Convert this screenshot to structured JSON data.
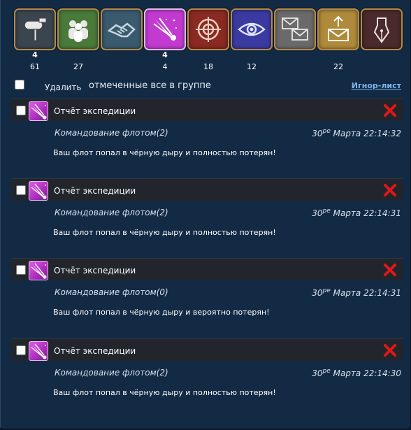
{
  "categories": [
    {
      "name": "postbox",
      "icon": "mailbox-icon",
      "new": "4",
      "count": "61",
      "bg": "#3a4550"
    },
    {
      "name": "alliance",
      "icon": "people-icon",
      "new": "",
      "count": "27",
      "bg": "#4a7a3a"
    },
    {
      "name": "trade",
      "icon": "handshake-icon",
      "new": "",
      "count": "",
      "bg": "#3a5a6e"
    },
    {
      "name": "expeditions",
      "icon": "comet-icon",
      "new": "4",
      "count": "4",
      "bg": "#c23ad0"
    },
    {
      "name": "combat",
      "icon": "crosshair-icon",
      "new": "",
      "count": "18",
      "bg": "#8a2a22"
    },
    {
      "name": "espionage",
      "icon": "eye-icon",
      "new": "",
      "count": "12",
      "bg": "#3a3aa0"
    },
    {
      "name": "system",
      "icon": "envelopes-icon",
      "new": "",
      "count": "",
      "bg": "#6a6a6a"
    },
    {
      "name": "outbox",
      "icon": "envelope-upload-icon",
      "new": "",
      "count": "22",
      "bg": "#b08a3a"
    },
    {
      "name": "notes",
      "icon": "pen-nib-icon",
      "new": "",
      "count": "",
      "bg": "#4a2a2a"
    }
  ],
  "toolbar": {
    "delete_label": "Удалить",
    "select_value": "отмеченные все в группе",
    "ignore_label": "Игнор-лист"
  },
  "messages": [
    {
      "title": "Отчёт экспедиции",
      "from": "Командование флотом(2)",
      "date_day": "30",
      "date_suffix": "ре",
      "date_rest": "Марта 22:14:32",
      "body": "Ваш флот попал в чёрную дыру и полностью потерян!"
    },
    {
      "title": "Отчёт экспедиции",
      "from": "Командование флотом(2)",
      "date_day": "30",
      "date_suffix": "ре",
      "date_rest": "Марта 22:14:31",
      "body": "Ваш флот попал в чёрную дыру и полностью потерян!"
    },
    {
      "title": "Отчёт экспедиции",
      "from": "Командование флотом(0)",
      "date_day": "30",
      "date_suffix": "ре",
      "date_rest": "Марта 22:14:31",
      "body": "Ваш флот попал в чёрную дыру и вероятно потерян!"
    },
    {
      "title": "Отчёт экспедиции",
      "from": "Командование флотом(2)",
      "date_day": "30",
      "date_suffix": "ре",
      "date_rest": "Марта 22:14:30",
      "body": "Ваш флот попал в чёрную дыру и полностью потерян!"
    }
  ]
}
